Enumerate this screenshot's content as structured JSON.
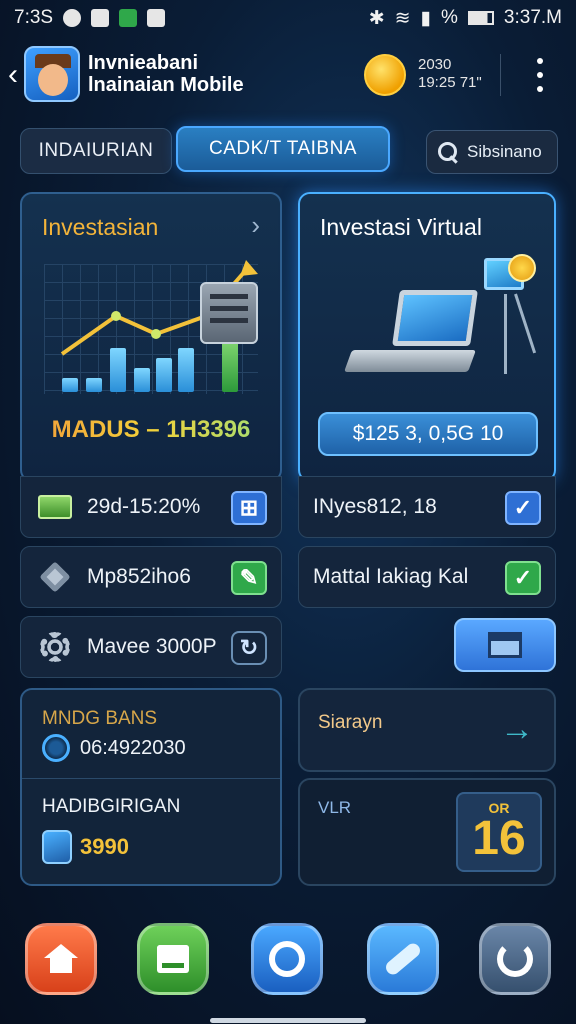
{
  "status_bar": {
    "time_left": "7:3S",
    "time_right": "3:37.M",
    "battery_percent_glyph": "%"
  },
  "header": {
    "title_line1": "Invnieabani",
    "title_line2": "lnainaian Mobile",
    "coin_line1": "2030",
    "coin_line2": "19:25 71\""
  },
  "tabs": [
    {
      "label": "INDAIURIAN",
      "active": false
    },
    {
      "label": "CADK/T TAIBNA",
      "active": true
    }
  ],
  "search": {
    "label": "Sibsinano"
  },
  "invest_card": {
    "title": "Investasian",
    "metric": "MADUS – 1H3396"
  },
  "virtual_card": {
    "title": "Investasi Virtual",
    "amount_button": "$125 3, 0,5G 10"
  },
  "rows": {
    "invest_stat": "29d-15:20%",
    "virtual_stat": "INyes812, 18",
    "mp": "Mp852iho6",
    "mattal": "Mattal Iakiag Kal",
    "mavee": "Mavee 3000P"
  },
  "bans_card": {
    "title": "MNDG BANS",
    "value": "06:4922030",
    "sub_title": "HADIBGIRIGAN",
    "sub_value": "3990"
  },
  "siarayn_card": {
    "label": "Siarayn"
  },
  "vlr_card": {
    "label": "VLR",
    "badge_sup": "OR",
    "badge_num": "16"
  },
  "nav": [
    {
      "icon": "home-icon"
    },
    {
      "icon": "store-icon"
    },
    {
      "icon": "refresh-icon"
    },
    {
      "icon": "tools-icon"
    },
    {
      "icon": "sync-icon"
    }
  ],
  "colors": {
    "accent_blue": "#2a7fc2",
    "accent_gold": "#f3b43a",
    "success_green": "#2fa84a",
    "background": "#0a1d36"
  }
}
